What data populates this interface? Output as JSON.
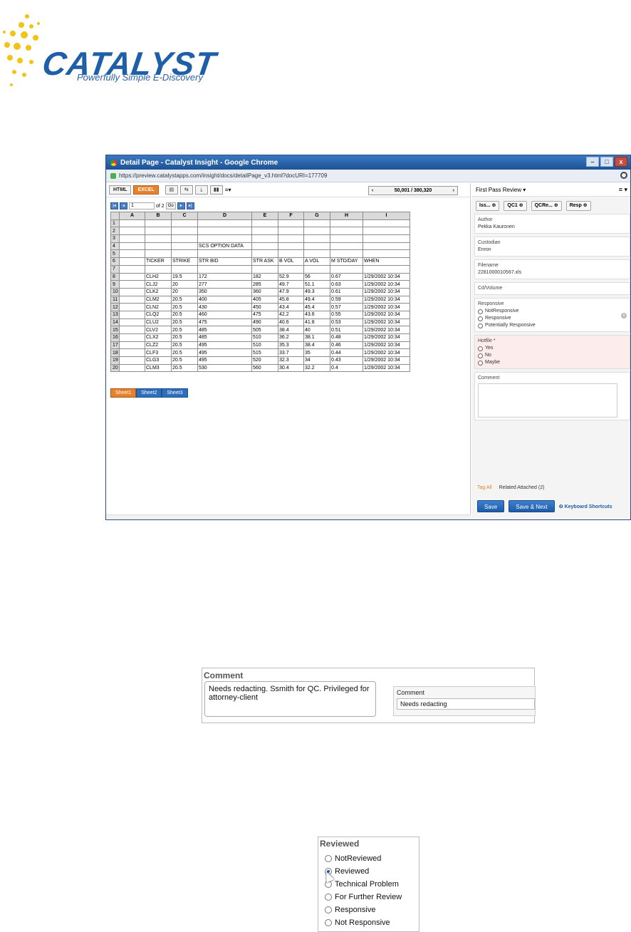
{
  "logo": {
    "word": "CATALYST",
    "tagline": "Powerfully Simple E-Discovery"
  },
  "window": {
    "title": "Detail Page - Catalyst Insight - Google Chrome",
    "url": "https://preview.catalystapps.com/insight/docs/detailPage_v3.html?docURI=177709",
    "controls": [
      "–",
      "□",
      "x"
    ]
  },
  "viewer": {
    "tabs": [
      "HTML",
      "EXCEL"
    ],
    "pager": {
      "prev": "‹",
      "position": "50,001 / 380,320",
      "next": "›"
    },
    "sheet_nav": {
      "page": "1",
      "of": "of 2",
      "go": "Go"
    }
  },
  "sheet": {
    "columns": [
      "",
      "A",
      "B",
      "C",
      "D",
      "E",
      "F",
      "G",
      "H",
      "I"
    ],
    "rows": [
      [
        "1",
        "",
        "",
        "",
        "",
        "",
        "",
        "",
        "",
        ""
      ],
      [
        "2",
        "",
        "",
        "",
        "",
        "",
        "",
        "",
        "",
        ""
      ],
      [
        "3",
        "",
        "",
        "",
        "",
        "",
        "",
        "",
        "",
        ""
      ],
      [
        "4",
        "",
        "",
        "",
        "SCS OPTION DATA",
        "",
        "",
        "",
        "",
        ""
      ],
      [
        "5",
        "",
        "",
        "",
        "",
        "",
        "",
        "",
        "",
        ""
      ],
      [
        "6",
        "",
        "TICKER",
        "STRIKE",
        "STR BID",
        "STR ASK",
        "B VOL",
        "A VOL",
        "M STD/DAY",
        "WHEN"
      ],
      [
        "7",
        "",
        "",
        "",
        "",
        "",
        "",
        "",
        "",
        ""
      ],
      [
        "8",
        "",
        "CLH2",
        "19.5",
        "172",
        "182",
        "52.9",
        "56",
        "0.67",
        "1/29/2002 10:34"
      ],
      [
        "9",
        "",
        "CLJ2",
        "20",
        "277",
        "285",
        "49.7",
        "51.1",
        "0.63",
        "1/29/2002 10:34"
      ],
      [
        "10",
        "",
        "CLK2",
        "20",
        "350",
        "360",
        "47.9",
        "49.3",
        "0.61",
        "1/29/2002 10:34"
      ],
      [
        "11",
        "",
        "CLM2",
        "20.5",
        "400",
        "405",
        "45.8",
        "49.4",
        "0.59",
        "1/29/2002 10:34"
      ],
      [
        "12",
        "",
        "CLN2",
        "20.5",
        "430",
        "450",
        "43.4",
        "45.4",
        "0.57",
        "1/29/2002 10:34"
      ],
      [
        "13",
        "",
        "CLQ2",
        "20.5",
        "460",
        "475",
        "42.2",
        "43.6",
        "0.55",
        "1/29/2002 10:34"
      ],
      [
        "14",
        "",
        "CLU2",
        "20.5",
        "475",
        "490",
        "40.6",
        "41.8",
        "0.53",
        "1/29/2002 10:34"
      ],
      [
        "15",
        "",
        "CLV2",
        "20.5",
        "485",
        "505",
        "38.4",
        "40",
        "0.51",
        "1/29/2002 10:34"
      ],
      [
        "16",
        "",
        "CLX2",
        "20.5",
        "485",
        "510",
        "36.2",
        "38.1",
        "0.48",
        "1/29/2002 10:34"
      ],
      [
        "17",
        "",
        "CLZ2",
        "20.5",
        "495",
        "510",
        "35.3",
        "38.4",
        "0.46",
        "1/29/2002 10:34"
      ],
      [
        "18",
        "",
        "CLF3",
        "20.5",
        "495",
        "515",
        "33.7",
        "35",
        "0.44",
        "1/29/2002 10:34"
      ],
      [
        "19",
        "",
        "CLG3",
        "20.5",
        "495",
        "520",
        "32.3",
        "34",
        "0.43",
        "1/29/2002 10:34"
      ],
      [
        "20",
        "",
        "CLM3",
        "20.5",
        "530",
        "560",
        "30.4",
        "32.2",
        "0.4",
        "1/29/2002 10:34"
      ]
    ],
    "sheet_tabs": [
      "Sheet1",
      "Sheet2",
      "Sheet3"
    ]
  },
  "review_panel": {
    "title": "First Pass Review ▾",
    "menu": "≡ ▾",
    "buttons": [
      "Iss... ⊕",
      "QC1 ⊕",
      "QCRe... ⊕",
      "Resp ⊕"
    ],
    "author_label": "Author",
    "author_value": "Pekka Kauronen",
    "custodian_label": "Custodian",
    "custodian_value": "Enron",
    "filename_label": "Filename",
    "filename_value": "2281000010567.xls",
    "volume_label": "Cd/Volume",
    "responsive_label": "Responsive",
    "responsive_options": [
      "NotResponsive",
      "Responsive",
      "Potentially Responsive"
    ],
    "hotfile_label": "Hotfile *",
    "hotfile_options": [
      "Yes",
      "No",
      "Maybe"
    ],
    "comment_label": "Comment",
    "tag_all": "Tag All",
    "related": "Related Attached (2)",
    "save": "Save",
    "save_next": "Save & Next",
    "shortcuts": "❷ Keyboard Shortcuts"
  },
  "comment_inset": {
    "title": "Comment",
    "text": "Needs redacting. Ssmith for QC. Privileged for attorney-client",
    "right_label": "Comment",
    "right_value": "Needs redacting"
  },
  "reviewed_inset": {
    "title": "Reviewed",
    "options": [
      "NotReviewed",
      "Reviewed",
      "Technical Problem",
      "For Further Review",
      "Responsive",
      "Not Responsive"
    ],
    "selected": "Reviewed"
  }
}
